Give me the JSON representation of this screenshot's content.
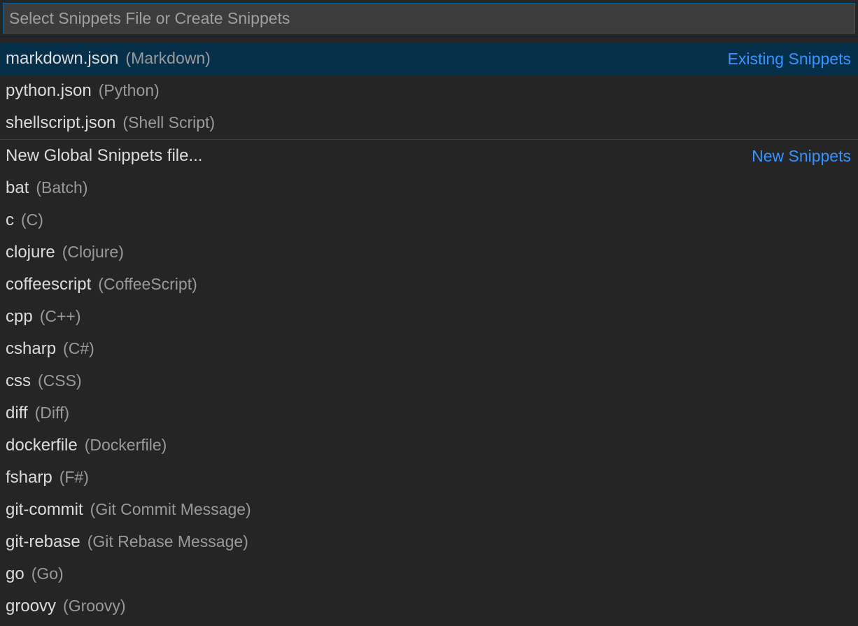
{
  "search": {
    "placeholder": "Select Snippets File or Create Snippets",
    "value": ""
  },
  "section_labels": {
    "existing": "Existing Snippets",
    "new": "New Snippets"
  },
  "existing_items": [
    {
      "label": "markdown.json",
      "description": "(Markdown)",
      "selected": true
    },
    {
      "label": "python.json",
      "description": "(Python)",
      "selected": false
    },
    {
      "label": "shellscript.json",
      "description": "(Shell Script)",
      "selected": false
    }
  ],
  "new_items": [
    {
      "label": "New Global Snippets file...",
      "description": ""
    },
    {
      "label": "bat",
      "description": "(Batch)"
    },
    {
      "label": "c",
      "description": "(C)"
    },
    {
      "label": "clojure",
      "description": "(Clojure)"
    },
    {
      "label": "coffeescript",
      "description": "(CoffeeScript)"
    },
    {
      "label": "cpp",
      "description": "(C++)"
    },
    {
      "label": "csharp",
      "description": "(C#)"
    },
    {
      "label": "css",
      "description": "(CSS)"
    },
    {
      "label": "diff",
      "description": "(Diff)"
    },
    {
      "label": "dockerfile",
      "description": "(Dockerfile)"
    },
    {
      "label": "fsharp",
      "description": "(F#)"
    },
    {
      "label": "git-commit",
      "description": "(Git Commit Message)"
    },
    {
      "label": "git-rebase",
      "description": "(Git Rebase Message)"
    },
    {
      "label": "go",
      "description": "(Go)"
    },
    {
      "label": "groovy",
      "description": "(Groovy)"
    }
  ]
}
